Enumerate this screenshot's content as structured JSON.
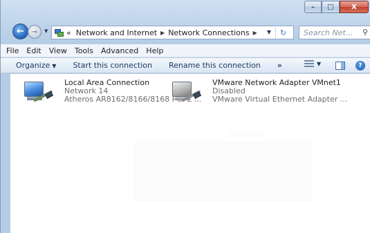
{
  "window": {
    "caption_buttons": {
      "minimize": "–",
      "maximize": "□",
      "close": "X"
    }
  },
  "address_bar": {
    "overflow": "«",
    "path": [
      "Network and Internet",
      "Network Connections"
    ],
    "refresh_glyph": "↻"
  },
  "search": {
    "placeholder": "Search Net..."
  },
  "menu": [
    "File",
    "Edit",
    "View",
    "Tools",
    "Advanced",
    "Help"
  ],
  "command_bar": {
    "organize": "Organize",
    "start": "Start this connection",
    "rename": "Rename this connection",
    "more": "»",
    "help": "?"
  },
  "connections": [
    {
      "name": "Local Area Connection",
      "status": "Network 14",
      "device": "Atheros AR8162/8166/8168 PCI-E ...",
      "icon": "network-adapter-icon",
      "state": "enabled"
    },
    {
      "name": "VMware Network Adapter VMnet1",
      "status": "Disabled",
      "device": "VMware Virtual Ethernet Adapter ...",
      "icon": "network-adapter-icon",
      "state": "disabled"
    }
  ],
  "colors": {
    "chrome": "#bdd3ea",
    "command_text": "#1e395b",
    "secondary_text": "#6d6d6d"
  }
}
